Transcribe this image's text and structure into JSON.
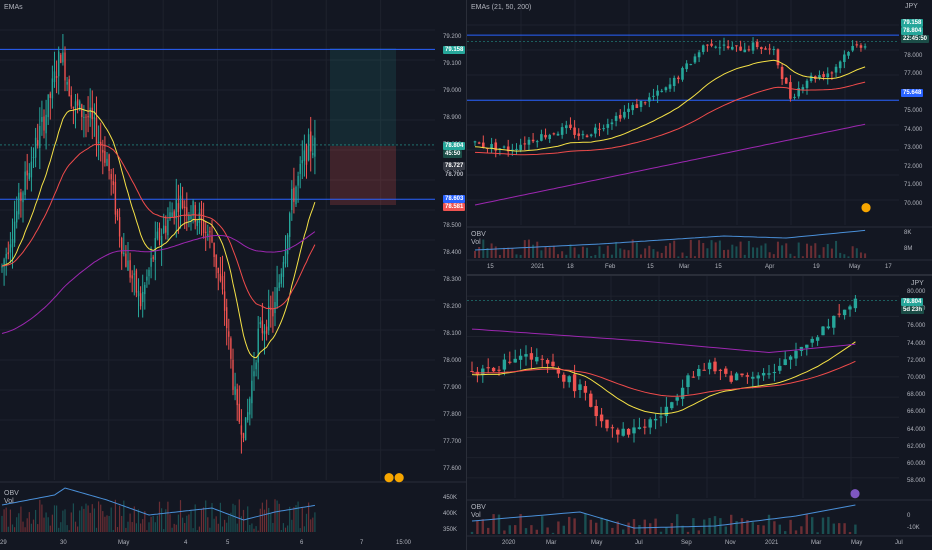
{
  "colors": {
    "bg": "#131722",
    "grid": "#1e222d",
    "up": "#26a69a",
    "down": "#ef5350",
    "ema21": "#f5e146",
    "ema50": "#ef4b4b",
    "ema200": "#9c27b0",
    "hline": "#2962ff"
  },
  "left": {
    "indicator_label": "EMAs",
    "obv_label": "OBV",
    "vol_label": "Vol",
    "price_ticks": [
      "79.200",
      "79.100",
      "79.000",
      "78.900",
      "78.800",
      "78.700",
      "78.600",
      "78.500",
      "78.400",
      "78.300",
      "78.200",
      "78.100",
      "78.000",
      "77.900",
      "77.800",
      "77.700",
      "77.600"
    ],
    "obv_ticks": [
      "450K",
      "400K",
      "350K"
    ],
    "time_ticks": [
      "29",
      "30",
      "May",
      "4",
      "5",
      "6",
      "7",
      "15:00"
    ],
    "badges": {
      "top": "79.158",
      "last": "78.804",
      "last_sub": "45:50",
      "b1": "78.727",
      "b2": "78.700",
      "b3": "78.603",
      "b4": "78.581"
    }
  },
  "tr": {
    "indicator_label": "EMAs (21, 50, 200)",
    "currency": "JPY",
    "obv_label": "OBV",
    "vol_label": "Vol",
    "price_ticks": [
      "79.000",
      "78.000",
      "77.000",
      "76.000",
      "75.000",
      "74.000",
      "73.000",
      "72.000",
      "71.000",
      "70.000"
    ],
    "obv_ticks": [
      "8K",
      "8M"
    ],
    "time_ticks": [
      "15",
      "2021",
      "18",
      "Feb",
      "15",
      "Mar",
      "15",
      "Apr",
      "19",
      "May",
      "17"
    ],
    "badges": {
      "top": "79.158",
      "last": "78.804",
      "last_sub": "22:45:50",
      "mid": "75.648"
    }
  },
  "br": {
    "currency": "JPY",
    "obv_label": "OBV",
    "vol_label": "Vol",
    "price_ticks": [
      "80.000",
      "78.000",
      "76.000",
      "74.000",
      "72.000",
      "70.000",
      "68.000",
      "66.000",
      "64.000",
      "62.000",
      "60.000",
      "58.000"
    ],
    "obv_ticks": [
      "0",
      "-10K"
    ],
    "time_ticks": [
      "2020",
      "Mar",
      "May",
      "Jul",
      "Sep",
      "Nov",
      "2021",
      "Mar",
      "May",
      "Jul"
    ],
    "badges": {
      "last": "78.804",
      "last_sub": "5d 23h"
    }
  }
}
